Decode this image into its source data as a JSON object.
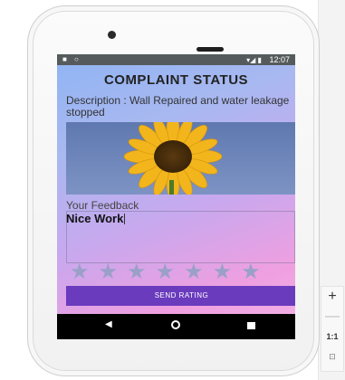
{
  "statusbar": {
    "time": "12:07",
    "left_icons": "■ ○",
    "signal": "▾◢ ▮"
  },
  "screen": {
    "title": "COMPLAINT STATUS",
    "description": "Description : Wall Repaired and water leakage stopped",
    "feedback_label": "Your Feedback",
    "feedback_value": "Nice Work",
    "send_button": "SEND RATING",
    "rating": {
      "value": 0,
      "max": 6
    }
  },
  "icons": {
    "nav_back": "◀",
    "nav_home": "circle",
    "nav_recent": "square",
    "star": "★"
  },
  "zoom_controls": {
    "plus": "+",
    "minus": "—",
    "ratio": "1:1",
    "fit": "⊡"
  },
  "colors": {
    "button": "#6a3bbd",
    "statusbar": "#555b5c",
    "star_empty": "#9aa0c8"
  }
}
